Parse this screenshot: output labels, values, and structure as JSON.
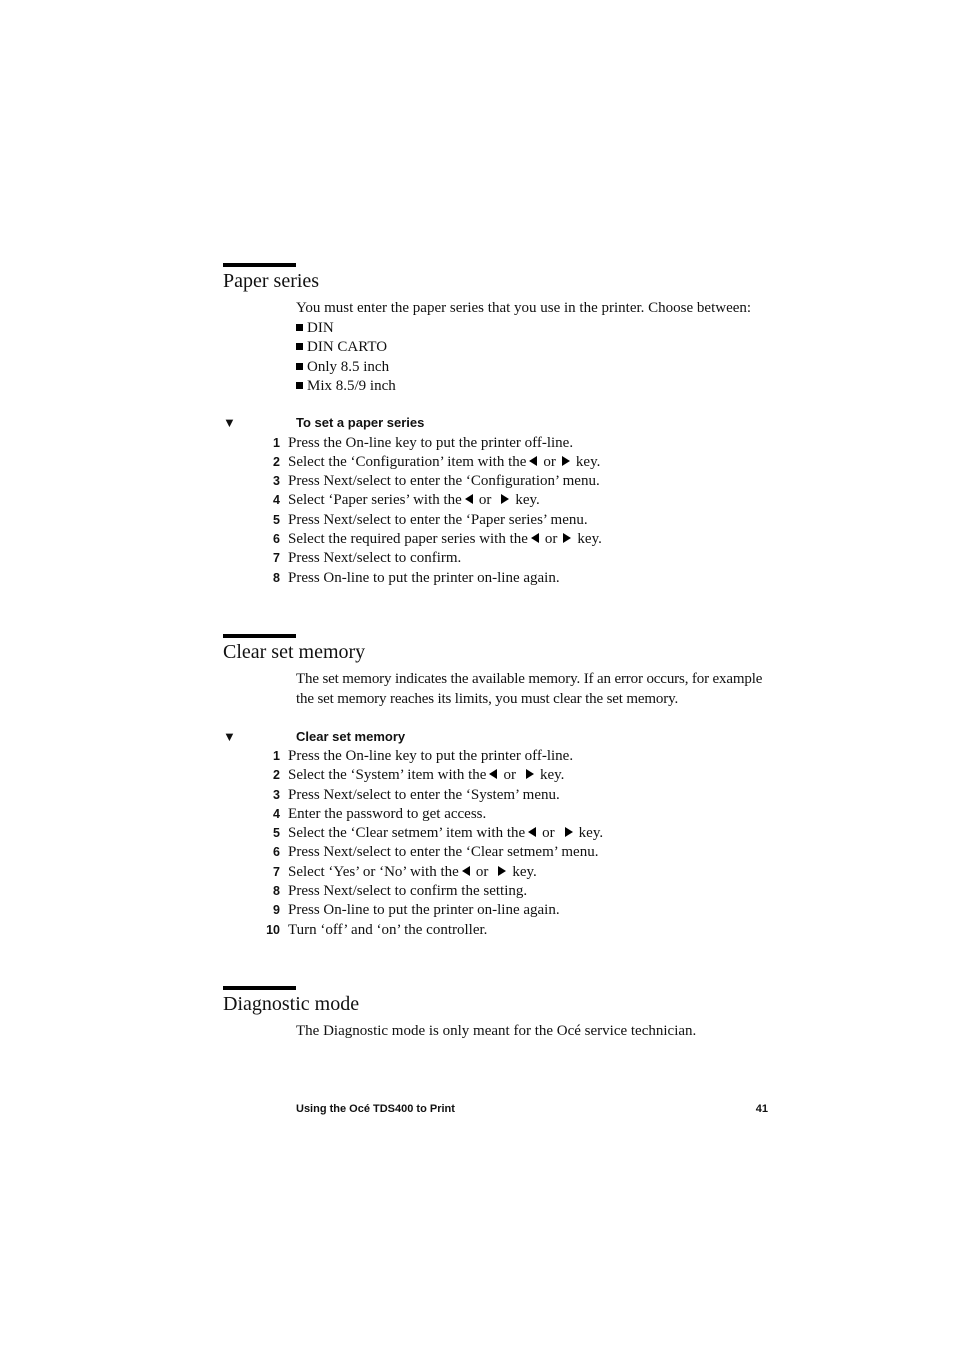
{
  "sections": [
    {
      "title": "Paper series",
      "intro": "You must enter the paper series that you use in the printer. Choose between:",
      "options": [
        "DIN",
        "DIN CARTO",
        "Only 8.5 inch",
        "Mix 8.5/9 inch"
      ],
      "procedure_title": "To set a paper series",
      "steps": [
        {
          "num": "1",
          "text": "Press the On-line key to put the printer off-line."
        },
        {
          "num": "2",
          "pre": "Select the ‘Configuration’ item with the",
          "mid": "or",
          "post": "key."
        },
        {
          "num": "3",
          "text": "Press Next/select to enter the ‘Configuration’ menu."
        },
        {
          "num": "4",
          "pre": "Select ‘Paper series’ with the",
          "mid": "or",
          "post": "key."
        },
        {
          "num": "5",
          "text": "Press Next/select to enter the ‘Paper series’ menu."
        },
        {
          "num": "6",
          "pre": "Select the required paper series with the",
          "mid": "or",
          "post": "key."
        },
        {
          "num": "7",
          "text": "Press Next/select to confirm."
        },
        {
          "num": "8",
          "text": "Press On-line to put the printer on-line again."
        }
      ]
    },
    {
      "title": "Clear set memory",
      "intro": "The set memory indicates the available memory. If an error occurs, for example the set memory reaches its limits, you must clear the set memory.",
      "procedure_title": "Clear set memory",
      "steps": [
        {
          "num": "1",
          "text": "Press the On-line key to put the printer off-line."
        },
        {
          "num": "2",
          "pre": "Select the ‘System’ item with the",
          "mid": "or",
          "post": "key."
        },
        {
          "num": "3",
          "text": "Press Next/select to enter the ‘System’ menu."
        },
        {
          "num": "4",
          "text": "Enter the password to get access."
        },
        {
          "num": "5",
          "pre": "Select the ‘Clear setmem’ item with the",
          "mid": "or",
          "post": "key."
        },
        {
          "num": "6",
          "text": "Press Next/select to enter the ‘Clear setmem’ menu."
        },
        {
          "num": "7",
          "pre": "Select ‘Yes’ or ‘No’ with the",
          "mid": "or",
          "post": "key."
        },
        {
          "num": "8",
          "text": "Press Next/select to confirm the setting."
        },
        {
          "num": "9",
          "text": "Press On-line to put the printer on-line again."
        },
        {
          "num": "10",
          "text": "Turn ‘off’ and ‘on’ the controller."
        }
      ]
    },
    {
      "title": "Diagnostic mode",
      "intro": "The Diagnostic mode is only meant for the Océ service technician."
    }
  ],
  "procedure_marker": "▼",
  "footer": {
    "title": "Using the Océ TDS400 to Print",
    "page_number": "41"
  }
}
